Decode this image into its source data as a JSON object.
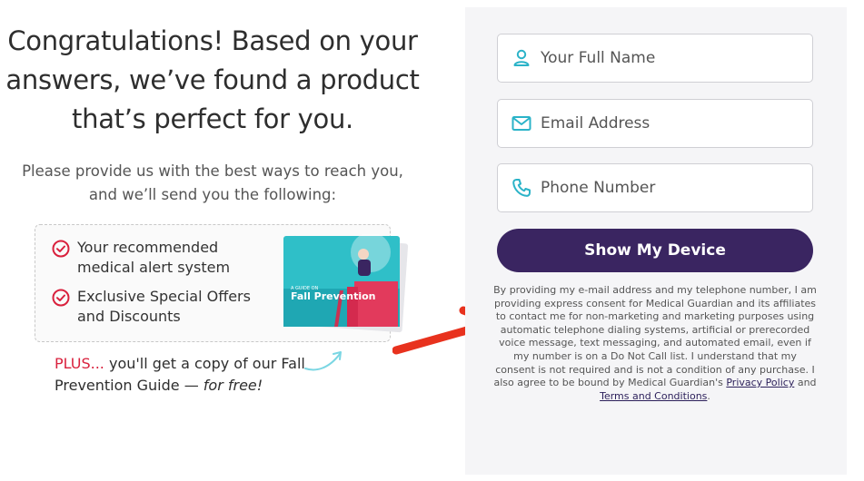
{
  "headline": "Congratulations! Based on your answers, we’ve found a product that’s perfect for you.",
  "subtext": "Please provide us with the best ways to reach you, and we’ll send you the following:",
  "offers": [
    {
      "label": "Your recommended medical alert system",
      "icon": "check-circle-icon"
    },
    {
      "label": "Exclusive Special Offers and Discounts",
      "icon": "check-circle-icon"
    }
  ],
  "guide": {
    "cover_text": "Fall Prevention",
    "subtitle": "A GUIDE ON"
  },
  "plus": {
    "prefix": "PLUS...",
    "main": " you'll get a copy of our Fall Prevention Guide — ",
    "free": "for free!"
  },
  "form": {
    "name_placeholder": "Your Full Name",
    "email_placeholder": "Email Address",
    "phone_placeholder": "Phone Number",
    "submit_label": "Show My Device",
    "consent_text": "By providing my e-mail address and my telephone number, I am providing express consent for Medical Guardian and its affiliates to contact me for non-marketing and marketing purposes using automatic telephone dialing systems, artificial or prerecorded voice message, text messaging, and automated email, even if my number is on a Do Not Call list. I understand that my consent is not required and is not a condition of any purchase. I also agree to be bound by Medical Guardian's ",
    "privacy_label": "Privacy Policy",
    "and_text": " and ",
    "terms_label": "Terms and Conditions",
    "end_text": "."
  },
  "colors": {
    "accent": "#3a2561",
    "icon": "#2bb3c8",
    "check": "#d9213d",
    "arrow": "#e8321e"
  }
}
